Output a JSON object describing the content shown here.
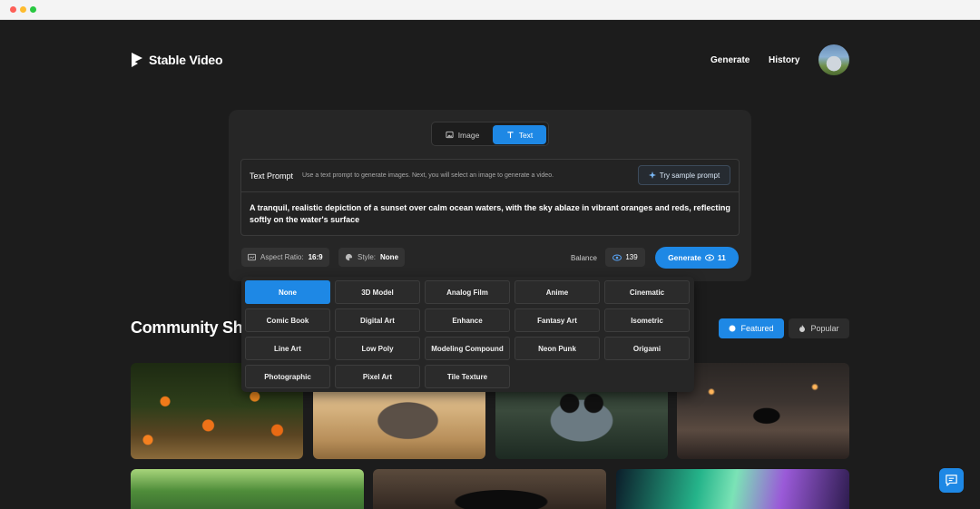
{
  "header": {
    "brand": "Stable Video",
    "nav": {
      "generate": "Generate",
      "history": "History"
    }
  },
  "generator": {
    "modes": {
      "image": "Image",
      "text": "Text",
      "active": "Text"
    },
    "prompt": {
      "title": "Text Prompt",
      "description": "Use a text prompt to generate images. Next, you will select an image to generate a video.",
      "sample_button": "Try sample prompt",
      "text": "A tranquil, realistic depiction of a sunset over calm ocean waters, with the sky ablaze in vibrant oranges and reds, reflecting softly on the water's surface"
    },
    "aspect_ratio": {
      "label": "Aspect Ratio:",
      "value": "16:9"
    },
    "style": {
      "label": "Style:",
      "value": "None"
    },
    "balance": {
      "label": "Balance",
      "value": "139"
    },
    "generate": {
      "label": "Generate",
      "cost": "11"
    }
  },
  "style_options": {
    "selected": "None",
    "items": [
      "None",
      "3D Model",
      "Analog Film",
      "Anime",
      "Cinematic",
      "Comic Book",
      "Digital Art",
      "Enhance",
      "Fantasy Art",
      "Isometric",
      "Line Art",
      "Low Poly",
      "Modeling Compound",
      "Neon Punk",
      "Origami",
      "Photographic",
      "Pixel Art",
      "Tile Texture"
    ]
  },
  "community": {
    "title": "Community Showcase",
    "tabs": {
      "featured": "Featured",
      "popular": "Popular",
      "active": "Featured"
    }
  },
  "colors": {
    "accent": "#1e88e5",
    "background": "#1c1c1c",
    "card": "#262626"
  },
  "icons": {
    "logo": "stable-video-logo-icon",
    "image_tab": "image-icon",
    "text_tab": "text-t-icon",
    "sample": "sparkle-icon",
    "aspect": "aspect-ratio-icon",
    "style": "palette-icon",
    "balance": "eye-credit-icon",
    "featured": "dot-icon",
    "popular": "flame-icon",
    "chat": "chat-feedback-icon"
  }
}
